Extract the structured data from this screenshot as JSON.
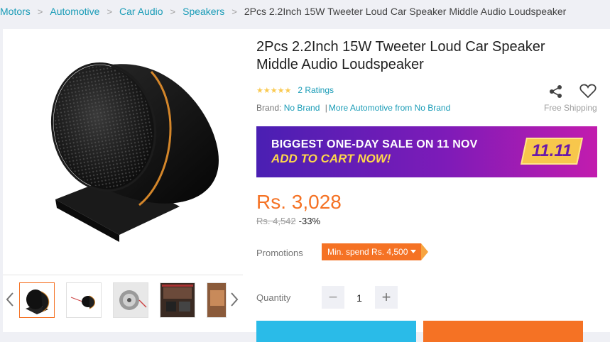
{
  "breadcrumb": [
    {
      "label": "Motors"
    },
    {
      "label": "Automotive"
    },
    {
      "label": "Car Audio"
    },
    {
      "label": "Speakers"
    }
  ],
  "breadcrumb_current": "2Pcs 2.2Inch 15W Tweeter Loud Car Speaker Middle Audio Loudspeaker",
  "product": {
    "title": "2Pcs 2.2Inch 15W Tweeter Loud Car Speaker Middle Audio Loudspeaker",
    "stars": "★★★★★",
    "ratings": "2 Ratings",
    "brand_label": "Brand:",
    "brand": "No Brand",
    "more_link": "More Automotive from No Brand",
    "free_shipping": "Free Shipping",
    "price": "Rs. 3,028",
    "original_price": "Rs. 4,542",
    "discount": "-33%"
  },
  "banner": {
    "line1": "BIGGEST ONE-DAY SALE ON 11 NOV",
    "line2": "ADD TO CART NOW!",
    "badge": "11.11"
  },
  "promotions": {
    "label": "Promotions",
    "tag": "Min. spend Rs. 4,500"
  },
  "quantity": {
    "label": "Quantity",
    "minus": "−",
    "plus": "+",
    "value": "1"
  },
  "colors": {
    "accent": "#f57224",
    "link": "#1a9cb7",
    "buy": "#2abbe8"
  },
  "icons": {
    "share": "share-icon",
    "wishlist": "heart-icon",
    "prev": "chevron-left-icon",
    "next": "chevron-right-icon"
  }
}
